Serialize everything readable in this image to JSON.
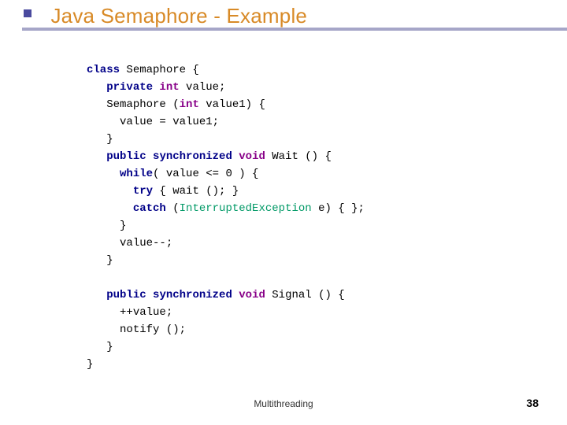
{
  "title": "Java Semaphore - Example",
  "footer": "Multithreading",
  "page": "38",
  "code": {
    "l1": {
      "kw1": "class",
      "id": " Semaphore {"
    },
    "l2": {
      "kw1": "private",
      "kw2": " int",
      "id": " value;"
    },
    "l3": {
      "id1": "Semaphore (",
      "kw1": "int",
      "id2": " value1) {"
    },
    "l4": {
      "id": "value = value1;"
    },
    "l5": {
      "id": "}"
    },
    "l6": {
      "kw1": "public",
      "kw2": " synchronized",
      "kw3": " void",
      "id": " Wait () {"
    },
    "l7": {
      "kw1": "while",
      "id": "( value <= 0 ) {"
    },
    "l8": {
      "kw1": "try",
      "id": " { wait (); }"
    },
    "l9": {
      "kw1": "catch",
      "id1": " (",
      "exc": "InterruptedException",
      "id2": " e) { };"
    },
    "l10": {
      "id": "}"
    },
    "l11": {
      "id": "value--;"
    },
    "l12": {
      "id": "}"
    },
    "l13": {
      "id": ""
    },
    "l14": {
      "kw1": "public",
      "kw2": " synchronized",
      "kw3": " void",
      "id": " Signal () {"
    },
    "l15": {
      "id": "++value;"
    },
    "l16": {
      "id": "notify ();"
    },
    "l17": {
      "id": "}"
    },
    "l18": {
      "id": "}"
    }
  }
}
